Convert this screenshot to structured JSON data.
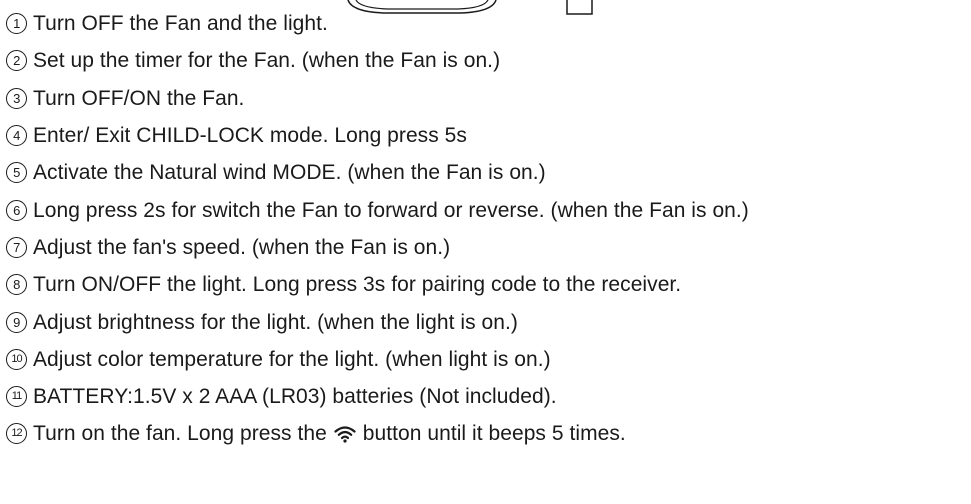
{
  "instructions": [
    {
      "number": "1",
      "text": "Turn OFF the Fan and the light."
    },
    {
      "number": "2",
      "text": "Set up the timer for the Fan. (when the Fan is on.)"
    },
    {
      "number": "3",
      "text": "Turn OFF/ON the Fan."
    },
    {
      "number": "4",
      "text": "Enter/ Exit CHILD-LOCK mode. Long press 5s"
    },
    {
      "number": "5",
      "text": "Activate the Natural wind MODE. (when the Fan is on.)"
    },
    {
      "number": "6",
      "text": "Long press 2s for switch the Fan to forward or reverse. (when the Fan is on.)"
    },
    {
      "number": "7",
      "text": "Adjust the fan's speed. (when the Fan is on.)"
    },
    {
      "number": "8",
      "text": "Turn ON/OFF the light. Long press 3s for pairing code to the receiver."
    },
    {
      "number": "9",
      "text": "Adjust brightness for the light. (when the light is on.)"
    },
    {
      "number": "10",
      "text": "Adjust color temperature for the light. (when light is on.)"
    },
    {
      "number": "11",
      "text": "BATTERY:1.5V x 2 AAA (LR03) batteries (Not included)."
    },
    {
      "number": "12",
      "text_before": "Turn on the fan. Long press the",
      "icon": "wifi-signal-icon",
      "text_after": "button until it beeps 5 times."
    }
  ],
  "colors": {
    "text": "#1a1a1a",
    "background": "#ffffff"
  }
}
